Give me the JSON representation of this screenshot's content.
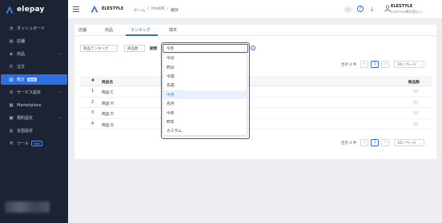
{
  "app": {
    "logo_text": "elepay"
  },
  "sidebar": {
    "items": [
      {
        "label": "ダッシュボード",
        "icon": "dashboard-icon",
        "chevron": ""
      },
      {
        "label": "店舗",
        "icon": "store-icon",
        "chevron": ""
      },
      {
        "label": "商品",
        "icon": "tag-icon",
        "chevron": "⌄"
      },
      {
        "label": "注文",
        "icon": "order-icon",
        "chevron": ""
      },
      {
        "label": "統計",
        "icon": "chart-icon",
        "chevron": "",
        "badge": "Beta",
        "active": true
      },
      {
        "label": "サービス設定",
        "icon": "service-icon",
        "chevron": "⌄"
      },
      {
        "label": "Marketplace",
        "icon": "marketplace-icon",
        "chevron": ""
      },
      {
        "label": "規約設定",
        "icon": "terms-icon",
        "chevron": "⌄"
      },
      {
        "label": "言語設定",
        "icon": "language-icon",
        "chevron": ""
      },
      {
        "label": "ツール",
        "icon": "tool-icon",
        "chevron": "",
        "badge": "New"
      }
    ]
  },
  "header": {
    "brand_name": "ELESTYLE",
    "breadcrumb": [
      "ホーム",
      "OneQR",
      "統計"
    ],
    "breadcrumb_sep": "/",
    "help_glyph": "?",
    "download_glyph": "⤓",
    "user_name": "ELESTYLE",
    "user_sub": "ELESTYLE株式会社(テ..."
  },
  "tabs": [
    {
      "label": "店舗",
      "active": false
    },
    {
      "label": "商品",
      "active": false
    },
    {
      "label": "ランキング",
      "active": true
    },
    {
      "label": "端末",
      "active": false
    }
  ],
  "filters": {
    "ranking_type": "商品ランキング",
    "metric": "商品数",
    "period_label": "期間",
    "period_value": "今月",
    "info_glyph": "?"
  },
  "pagination": {
    "total_text": "合計 4 件",
    "current_page": "1",
    "prev_glyph": "<",
    "next_glyph": ">",
    "page_size": "10 / ページ",
    "caret": "⌄"
  },
  "table": {
    "headers": [
      "#",
      "商品名",
      "商品数"
    ],
    "rows": [
      {
        "rank": "1",
        "name": "商品 C"
      },
      {
        "rank": "2",
        "name": "商品 H"
      },
      {
        "rank": "3",
        "name": "商品 D"
      },
      {
        "rank": "4",
        "name": "商品 G"
      }
    ]
  },
  "dropdown": {
    "options": [
      "今日",
      "昨日",
      "今週",
      "先週",
      "今月",
      "先月",
      "今年",
      "昨年",
      "カスタム"
    ],
    "selected": "今月"
  },
  "colors": {
    "primary": "#2f6fe4",
    "highlight": "#d81b6a",
    "sidebar_bg": "#1c2434"
  }
}
